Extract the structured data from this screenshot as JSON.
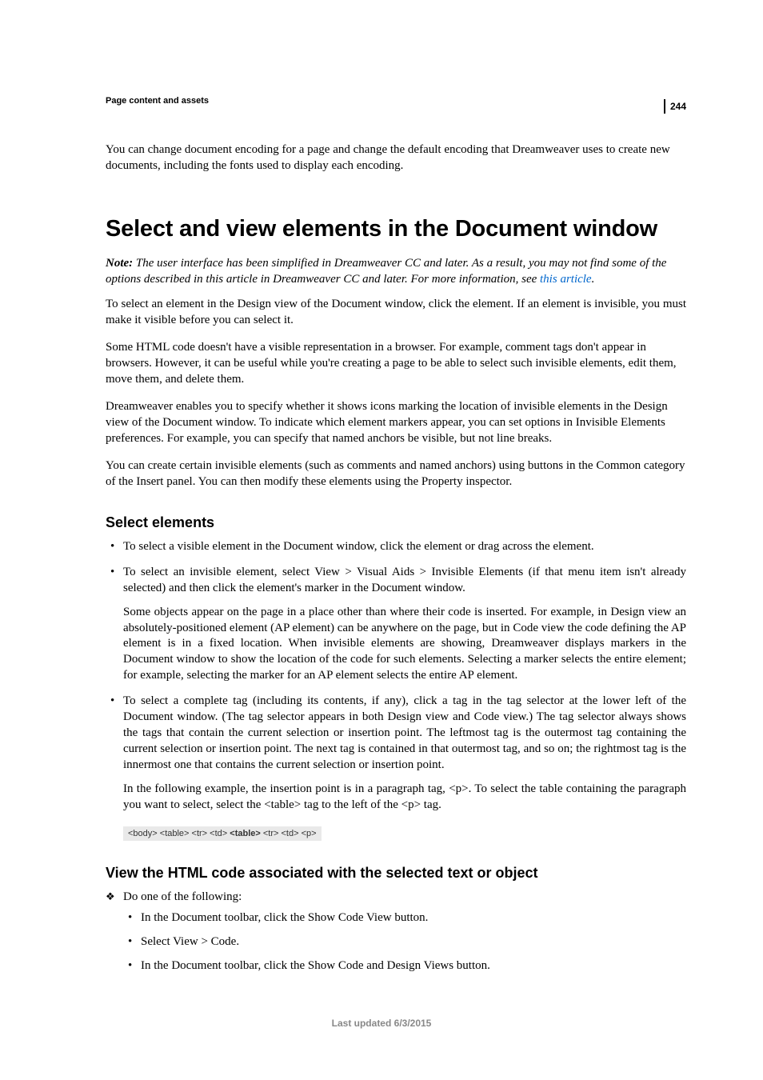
{
  "page_number": "244",
  "running_head": "Page content and assets",
  "intro_para": "You can change document encoding for a page and change the default encoding that Dreamweaver uses to create new documents, including the fonts used to display each encoding.",
  "section_title": "Select and view elements in the Document window",
  "note": {
    "label": "Note:",
    "text_before_link": " The user interface has been simplified in Dreamweaver CC and later. As a result, you may not find some of the options described in this article in Dreamweaver CC and later. For more information, see ",
    "link_text": "this article",
    "text_after_link": "."
  },
  "paras": {
    "p1": "To select an element in the Design view of the Document window, click the element. If an element is invisible, you must make it visible before you can select it.",
    "p2": "Some HTML code doesn't have a visible representation in a browser. For example, comment tags don't appear in browsers. However, it can be useful while you're creating a page to be able to select such invisible elements, edit them, move them, and delete them.",
    "p3": "Dreamweaver enables you to specify whether it shows icons marking the location of invisible elements in the Design view of the Document window. To indicate which element markers appear, you can set options in Invisible Elements preferences. For example, you can specify that named anchors be visible, but not line breaks.",
    "p4": "You can create certain invisible elements (such as comments and named anchors) using buttons in the Common category of the Insert panel. You can then modify these elements using the Property inspector."
  },
  "subhead1": "Select elements",
  "bullets": {
    "b1": "To select a visible element in the Document window, click the element or drag across the element.",
    "b2": {
      "lead": "To select an invisible element, select View > Visual Aids > Invisible Elements (if that menu item isn't already selected) and then click the element's marker in the Document window.",
      "extra": "Some objects appear on the page in a place other than where their code is inserted. For example, in Design view an absolutely-positioned element (AP element) can be anywhere on the page, but in Code view the code defining the AP element is in a fixed location. When invisible elements are showing, Dreamweaver displays markers in the Document window to show the location of the code for such elements. Selecting a marker selects the entire element; for example, selecting the marker for an AP element selects the entire AP element."
    },
    "b3": {
      "lead": "To select a complete tag (including its contents, if any), click a tag in the tag selector at the lower left of the Document window. (The tag selector appears in both Design view and Code view.) The tag selector always shows the tags that contain the current selection or insertion point. The leftmost tag is the outermost tag containing the current selection or insertion point. The next tag is contained in that outermost tag, and so on; the rightmost tag is the innermost one that contains the current selection or insertion point.",
      "extra": "In the following example, the insertion point is in a paragraph tag, <p>. To select the table containing the paragraph you want to select, select the <table> tag to the left of the <p> tag."
    }
  },
  "tag_selector": {
    "t1": "<body>",
    "t2": "<table>",
    "t3": "<tr>",
    "t4": "<td>",
    "t5": "<table>",
    "t6": "<tr>",
    "t7": "<td>",
    "t8": "<p>"
  },
  "subhead2": "View the HTML code associated with the selected text or object",
  "diamond_text": "Do one of the following:",
  "sub_bullets": {
    "s1": "In the Document toolbar, click the Show Code View button.",
    "s2": "Select View > Code.",
    "s3": "In the Document toolbar, click the Show Code and Design Views button."
  },
  "footer": "Last updated 6/3/2015"
}
